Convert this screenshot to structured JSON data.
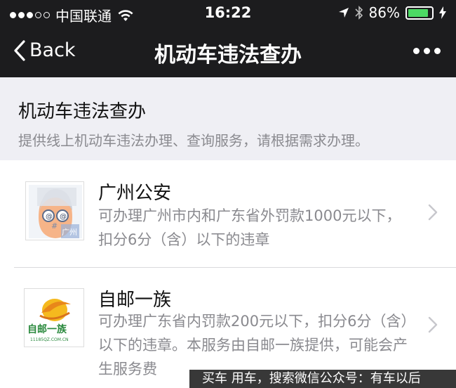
{
  "status_bar": {
    "carrier": "中国联通",
    "time": "16:22",
    "battery_percent": "86%",
    "battery_level": 0.86,
    "icons": [
      "signal-dots-icon",
      "wifi-icon",
      "location-arrow-icon",
      "bluetooth-icon",
      "battery-icon",
      "charging-bolt-icon"
    ]
  },
  "navbar": {
    "back_label": "Back",
    "title": "机动车违法查办"
  },
  "header": {
    "title": "机动车违法查办",
    "subtitle": "提供线上机动车违法办理、查询服务，请根据需求办理。"
  },
  "items": [
    {
      "title": "广州公安",
      "description": "可办理广州市内和广东省外罚款1000元以下，扣分6分（含）以下的违章",
      "logo_text": "广州"
    },
    {
      "title": "自邮一族",
      "description": "可办理广东省内罚款200元以下，扣分6分（含）以下的违章。本服务由自邮一族提供，可能会产生服务费",
      "logo_text": "自邮一族",
      "logo_subtext": "11185QZ.COM.CN"
    }
  ],
  "watermark": {
    "text": "买车 用车，搜索微信公众号：有车以后"
  },
  "colors": {
    "bar_bg": "#1c1c1e",
    "page_bg": "#efeff4",
    "battery_green": "#4cd964",
    "secondary_text": "#8a8a8f"
  }
}
